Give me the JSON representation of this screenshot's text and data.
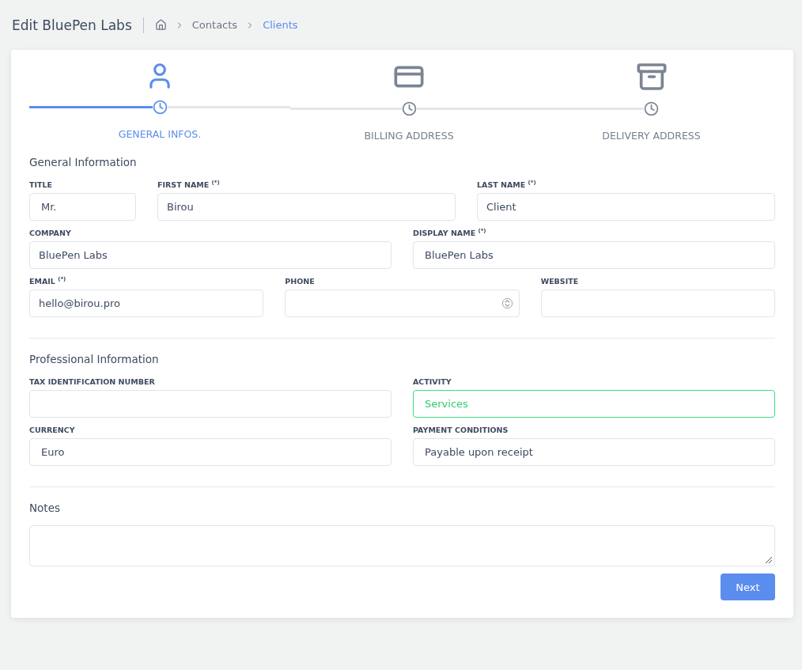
{
  "header": {
    "title": "Edit BluePen Labs",
    "breadcrumbs": [
      {
        "label": "Contacts",
        "current": false
      },
      {
        "label": "Clients",
        "current": true
      }
    ]
  },
  "steps": [
    {
      "label": "GENERAL INFOS.",
      "kind": "user",
      "selected": true
    },
    {
      "label": "BILLING ADDRESS",
      "kind": "card",
      "selected": false
    },
    {
      "label": "DELIVERY ADDRESS",
      "kind": "box",
      "selected": false
    }
  ],
  "sections": [
    {
      "title": "General Information",
      "rows": [
        [
          {
            "label": "TITLE",
            "value": "Mr.",
            "kind": "select",
            "valid": false
          },
          {
            "label": "FIRST NAME $^{(*)}$",
            "value": "Birou",
            "kind": "text",
            "valid": false
          },
          {
            "label": "LAST NAME $^{(*)}$",
            "value": "Client",
            "kind": "text",
            "valid": false
          }
        ],
        [
          {
            "label": "COMPANY",
            "value": "BluePen Labs",
            "kind": "text",
            "valid": false
          },
          {
            "label": "DISPLAY NAME $^{(*)}$",
            "value": "BluePen Labs",
            "kind": "select",
            "valid": false
          }
        ],
        [
          {
            "label": "EMAIL $^{(*)}$",
            "value": "hello@birou.pro",
            "kind": "text",
            "valid": false
          },
          {
            "label": "PHONE",
            "kind": "number",
            "valid": false
          },
          {
            "label": "WEBSITE",
            "kind": "text",
            "valid": false
          }
        ]
      ]
    },
    {
      "title": "Professional Information",
      "rows": [
        [
          {
            "label": "TAX IDENTIFICATION NUMBER",
            "kind": "text",
            "valid": false
          },
          {
            "label": "ACTIVITY",
            "value": "Services",
            "kind": "select",
            "valid": true
          }
        ],
        [
          {
            "label": "CURRENCY",
            "value": "Euro",
            "kind": "select",
            "valid": false
          },
          {
            "label": "PAYMENT CONDITIONS",
            "value": "Payable upon receipt",
            "kind": "select",
            "valid": false
          }
        ]
      ]
    },
    {
      "title": "Notes",
      "rows": [
        [
          {
            "kind": "textarea",
            "valid": false
          }
        ]
      ]
    }
  ],
  "next_button": "Next"
}
